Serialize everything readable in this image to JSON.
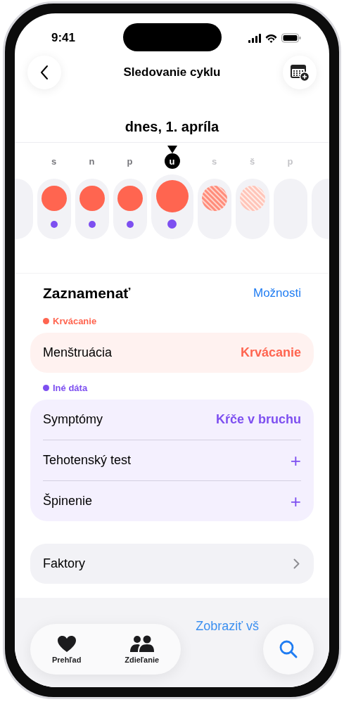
{
  "status_bar": {
    "time": "9:41"
  },
  "nav": {
    "title": "Sledovanie cyklu"
  },
  "date_heading": "dnes, 1. apríla",
  "days": [
    {
      "kind": "edge"
    },
    {
      "kind": "period",
      "letter": "s",
      "selected": false,
      "future": false,
      "other_data": true
    },
    {
      "kind": "period",
      "letter": "n",
      "selected": false,
      "future": false,
      "other_data": true
    },
    {
      "kind": "period",
      "letter": "p",
      "selected": false,
      "future": false,
      "other_data": true
    },
    {
      "kind": "period",
      "letter": "u",
      "selected": true,
      "future": false,
      "other_data": true
    },
    {
      "kind": "predicted",
      "letter": "s",
      "selected": false,
      "future": true,
      "other_data": false
    },
    {
      "kind": "predicted_faint",
      "letter": "š",
      "selected": false,
      "future": true,
      "other_data": false
    },
    {
      "kind": "empty",
      "letter": "p",
      "selected": false,
      "future": true,
      "other_data": false
    },
    {
      "kind": "edge"
    }
  ],
  "log": {
    "title": "Zaznamenať",
    "options_link": "Možnosti",
    "groups": [
      {
        "label": "Krvácanie",
        "color": "#ff6550",
        "rows": [
          {
            "kind": "value",
            "label": "Menštruácia",
            "value": "Krvácanie"
          }
        ]
      },
      {
        "label": "Iné dáta",
        "color": "#7d4ff0",
        "rows": [
          {
            "kind": "value",
            "label": "Symptómy",
            "value": "Kŕče v bruchu"
          },
          {
            "kind": "add",
            "label": "Tehotenský test",
            "action": "+"
          },
          {
            "kind": "add",
            "label": "Špinenie",
            "action": "+"
          }
        ]
      }
    ],
    "factors": {
      "label": "Faktory"
    }
  },
  "next_section": {
    "link": "Zobraziť vš"
  },
  "tab_bar": {
    "tabs": [
      {
        "kind": "heart",
        "label": "Prehľad"
      },
      {
        "kind": "people",
        "label": "Zdieľanie"
      }
    ]
  }
}
